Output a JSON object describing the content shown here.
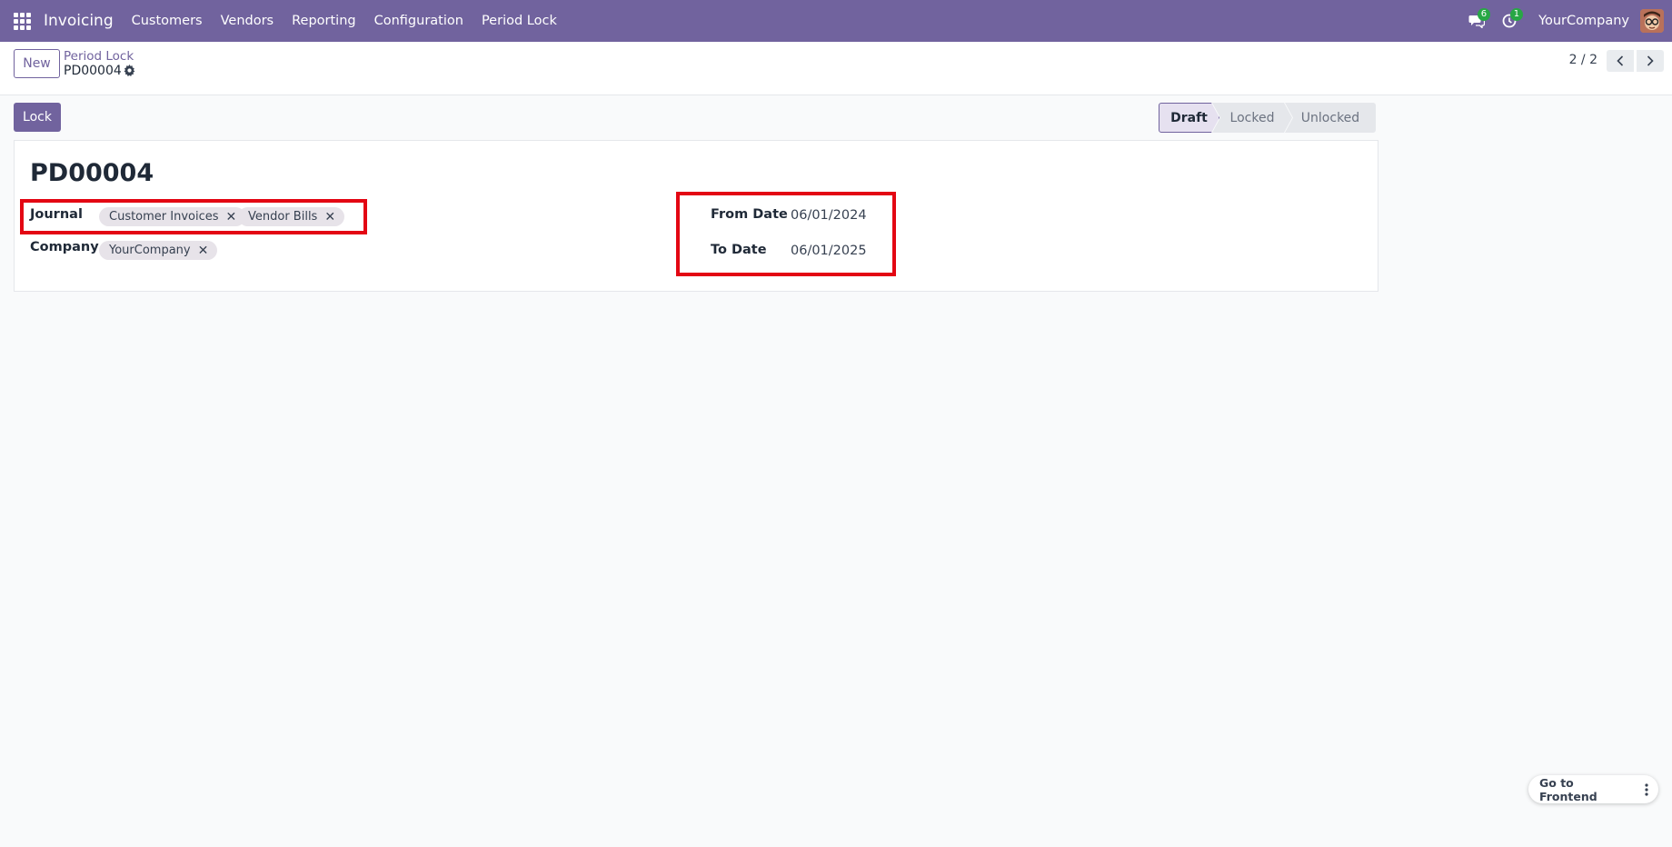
{
  "navbar": {
    "app_name": "Invoicing",
    "menu": [
      "Customers",
      "Vendors",
      "Reporting",
      "Configuration",
      "Period Lock"
    ],
    "messages_badge": "6",
    "activities_badge": "1",
    "company": "YourCompany",
    "bg_color": "#71639e"
  },
  "control_panel": {
    "new_label": "New",
    "breadcrumb": "Period Lock",
    "record_name": "PD00004",
    "pager": "2 / 2"
  },
  "actions": {
    "lock_label": "Lock"
  },
  "status": {
    "stages": [
      "Draft",
      "Locked",
      "Unlocked"
    ],
    "active": "Draft"
  },
  "form": {
    "title": "PD00004",
    "journal_label": "Journal",
    "journals": [
      "Customer Invoices",
      "Vendor Bills"
    ],
    "company_label": "Company",
    "company_tag": "YourCompany",
    "from_date_label": "From Date",
    "from_date": "06/01/2024",
    "to_date_label": "To Date",
    "to_date": "06/01/2025"
  },
  "frontend": {
    "label": "Go to Frontend"
  },
  "icons": [
    "apps-grid-icon",
    "chat-icon",
    "clock-icon",
    "gear-icon",
    "chevron-left-icon",
    "chevron-right-icon",
    "close-icon",
    "kebab-icon"
  ],
  "highlight_color": "#e30613"
}
